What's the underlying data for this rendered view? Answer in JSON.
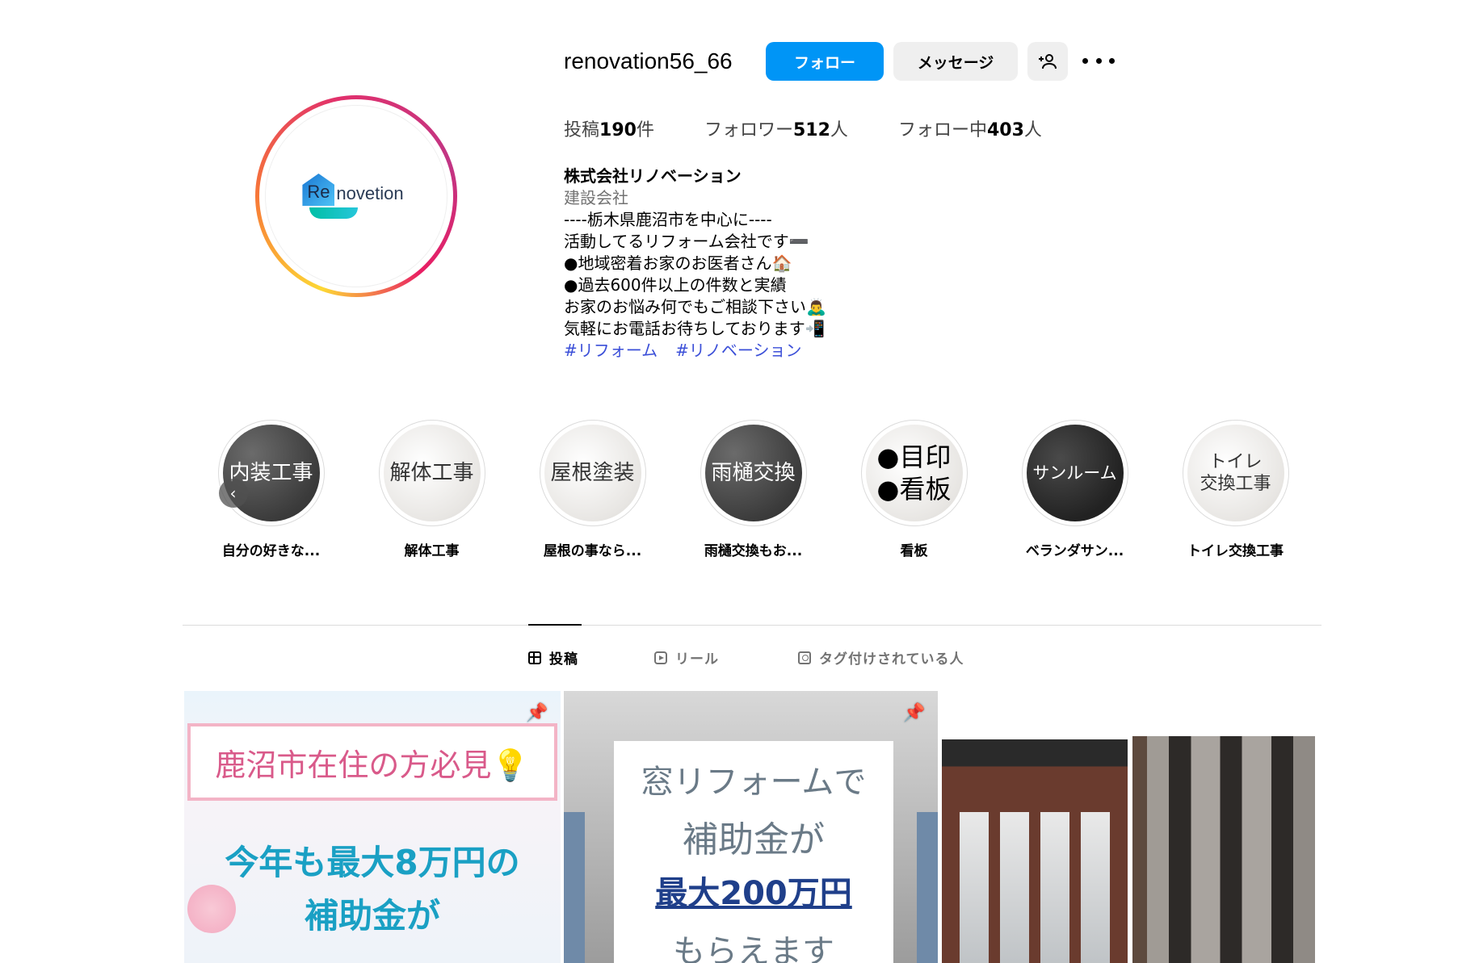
{
  "profile": {
    "username": "renovation56_66",
    "follow_label": "フォロー",
    "message_label": "メッセージ",
    "avatar_logo": {
      "letters": "Re",
      "word": "novetion"
    }
  },
  "stats": {
    "posts_prefix": "投稿",
    "posts_count": "190",
    "posts_suffix": "件",
    "followers_prefix": "フォロワー",
    "followers_count": "512",
    "followers_suffix": "人",
    "following_prefix": "フォロー中",
    "following_count": "403",
    "following_suffix": "人"
  },
  "bio": {
    "name": "株式会社リノベーション",
    "category": "建設会社",
    "lines": [
      "----栃木県鹿沼市を中心に----",
      "活動してるリフォーム会社です➖",
      "●地域密着お家のお医者さん🏠",
      "●過去600件以上の件数と実績",
      "お家のお悩み何でもご相談下さい🙇‍♂️",
      "気軽にお電話お待ちしております📲"
    ],
    "hashtags": [
      "#リフォーム",
      "#リノベーション"
    ]
  },
  "highlights": [
    {
      "cover": "内装工事",
      "label": "自分の好きな...",
      "theme": "dark"
    },
    {
      "cover": "解体工事",
      "label": "解体工事",
      "theme": "light"
    },
    {
      "cover": "屋根塗装",
      "label": "屋根の事なら...",
      "theme": "light"
    },
    {
      "cover": "雨樋交換",
      "label": "雨樋交換もお...",
      "theme": "dark"
    },
    {
      "cover": "●目印\n●看板",
      "label": "看板",
      "theme": "light"
    },
    {
      "cover": "サンルーム",
      "label": "ベランダサン...",
      "theme": "dark"
    },
    {
      "cover": "トイレ\n交換工事",
      "label": "トイレ交換工事",
      "theme": "light"
    }
  ],
  "tabs": {
    "posts": "投稿",
    "reels": "リール",
    "tagged": "タグ付けされている人"
  },
  "posts": {
    "p1": {
      "banner": "鹿沼市在住の方必見💡",
      "main_line1": "今年も最大8万円の",
      "main_line2": "補助金が"
    },
    "p2": {
      "line1": "窓リフォームで",
      "line2": "補助金が",
      "line3": "最大200万円",
      "line4": "もらえます"
    }
  },
  "colors": {
    "primary_button": "#0095f6",
    "secondary_button": "#efefef",
    "hashtag": "#3b4fd8",
    "muted_text": "#737373"
  }
}
